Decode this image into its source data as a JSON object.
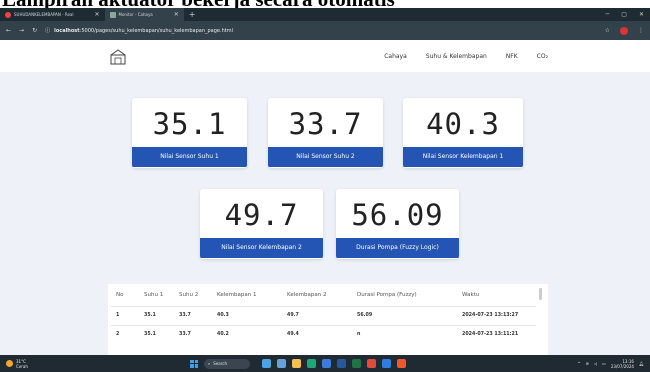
{
  "caption": "Lampiran aktuator bekerja secara otomatis",
  "browser": {
    "tabs": [
      {
        "label": "SUHUDANKELEMBAPAN - Real"
      },
      {
        "label": "Monitor - Cahaya"
      }
    ],
    "url_host": "localhost",
    "url_rest": ":5000/pages/suhu_kelembapan/suhu_kelembapan_page.html"
  },
  "nav": {
    "items": [
      "Cahaya",
      "Suhu & Kelembapan",
      "NFK",
      "CO₂"
    ]
  },
  "cards": [
    {
      "value": "35.1",
      "label": "Nilai Sensor Suhu 1"
    },
    {
      "value": "33.7",
      "label": "Nilai Sensor Suhu 2"
    },
    {
      "value": "40.3",
      "label": "Nilai Sensor Kelembapan 1"
    },
    {
      "value": "49.7",
      "label": "Nilai Sensor Kelembapan 2"
    },
    {
      "value": "56.09",
      "label": "Durasi Pompa (Fuzzy Logic)"
    }
  ],
  "table": {
    "headers": [
      "No",
      "Suhu 1",
      "Suhu 2",
      "Kelembapan 1",
      "Kelembapan 2",
      "Durasi Pompa (Fuzzy)",
      "Waktu"
    ],
    "rows": [
      [
        "1",
        "35.1",
        "33.7",
        "40.3",
        "49.7",
        "56.09",
        "2024-07-23 13:13:27"
      ],
      [
        "2",
        "35.1",
        "33.7",
        "40.2",
        "49.4",
        "n",
        "2024-07-23 13:11:21"
      ]
    ]
  },
  "taskbar": {
    "weather_temp": "31°C",
    "weather_desc": "Cerah",
    "search_placeholder": "Search",
    "time": "13:16",
    "date": "23/07/2024"
  },
  "colors": {
    "accent": "#2555b4",
    "page_bg": "#eef2f8"
  }
}
